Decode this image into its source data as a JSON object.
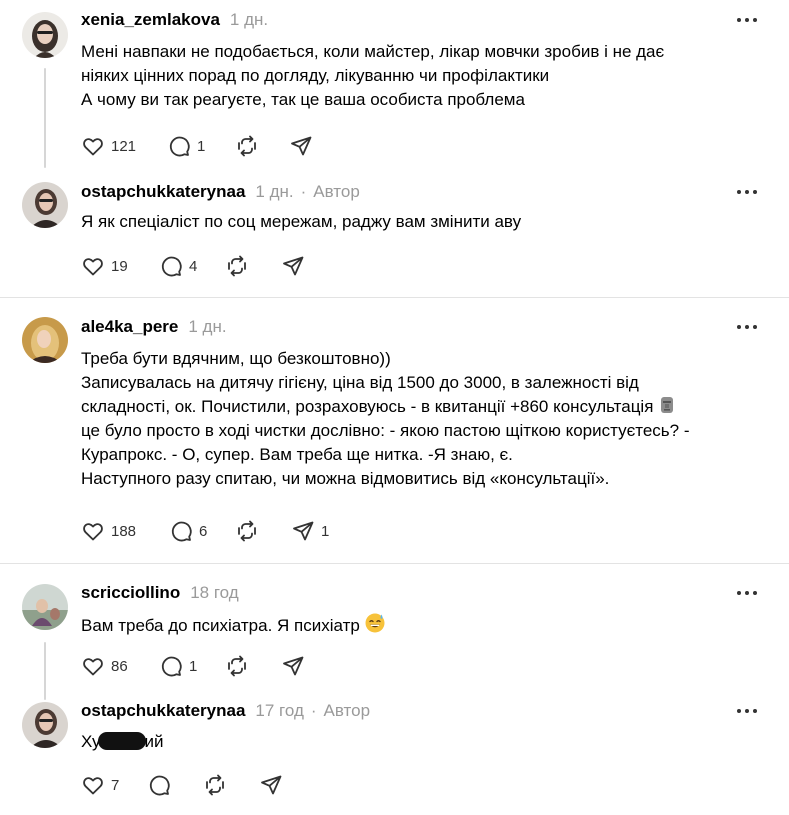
{
  "threads": [
    {
      "comment": {
        "username": "xenia_zemlakova",
        "time": "1 дн.",
        "author_badge": "",
        "lines": [
          "Мені навпаки не подобається, коли майстер, лікар мовчки зробив і не дає",
          "ніяких цінних порад по догляду, лікуванню чи профілактики",
          "А чому ви так реагуєте, так це ваша особиста проблема"
        ],
        "likes": "121",
        "replies": "1",
        "reposts": "",
        "shares": ""
      },
      "reply": {
        "username": "ostapchukkaterynaa",
        "time": "1 дн.",
        "author_badge": "Автор",
        "lines": [
          "Я як спеціаліст по соц мережам, раджу вам змінити аву"
        ],
        "likes": "19",
        "replies": "4",
        "reposts": "",
        "shares": ""
      }
    },
    {
      "comment": {
        "username": "ale4ka_pere",
        "time": "1 дн.",
        "author_badge": "",
        "lines": [
          "Треба бути вдячним, що безкоштовно))",
          "Записувалась на дитячу гігієну, ціна від 1500 до 3000, в залежності від",
          "складності, ок. Почистили, розраховуюсь - в квитанції +860 консультація",
          "це було просто в ході чистки дослівно: - якою пастою щіткою користуєтесь? -",
          "Курапрокс. - О, супер. Вам треба ще нитка. -Я знаю, є.",
          "Наступного разу спитаю, чи можна відмовитись від «консультації»."
        ],
        "emoji_after_line_3": "moai-emoji",
        "likes": "188",
        "replies": "6",
        "reposts": "",
        "shares": "1"
      }
    },
    {
      "comment": {
        "username": "scricciollino",
        "time": "18 год",
        "author_badge": "",
        "lines": [
          "Вам треба до психіатра. Я психіатр"
        ],
        "emoji_after_line_1": "smiling-face-with-sweat-emoji",
        "likes": "86",
        "replies": "1",
        "reposts": "",
        "shares": ""
      },
      "reply": {
        "username": "ostapchukkaterynaa",
        "time": "17 год",
        "author_badge": "Автор",
        "text_before_censor": "Ху",
        "text_after_censor": "ий",
        "likes": "7",
        "replies": "",
        "reposts": "",
        "shares": ""
      }
    }
  ],
  "separator": "·",
  "icons": {
    "like": "heart-icon",
    "reply": "comment-bubble-icon",
    "repost": "repost-arrows-icon",
    "share": "send-paper-plane-icon",
    "more": "more-dots-icon"
  },
  "colors": {
    "text": "#000000",
    "meta": "#9a9a9a",
    "icon": "#333333",
    "divider": "#e3e3e3",
    "thread_line": "#d6d6d6"
  }
}
